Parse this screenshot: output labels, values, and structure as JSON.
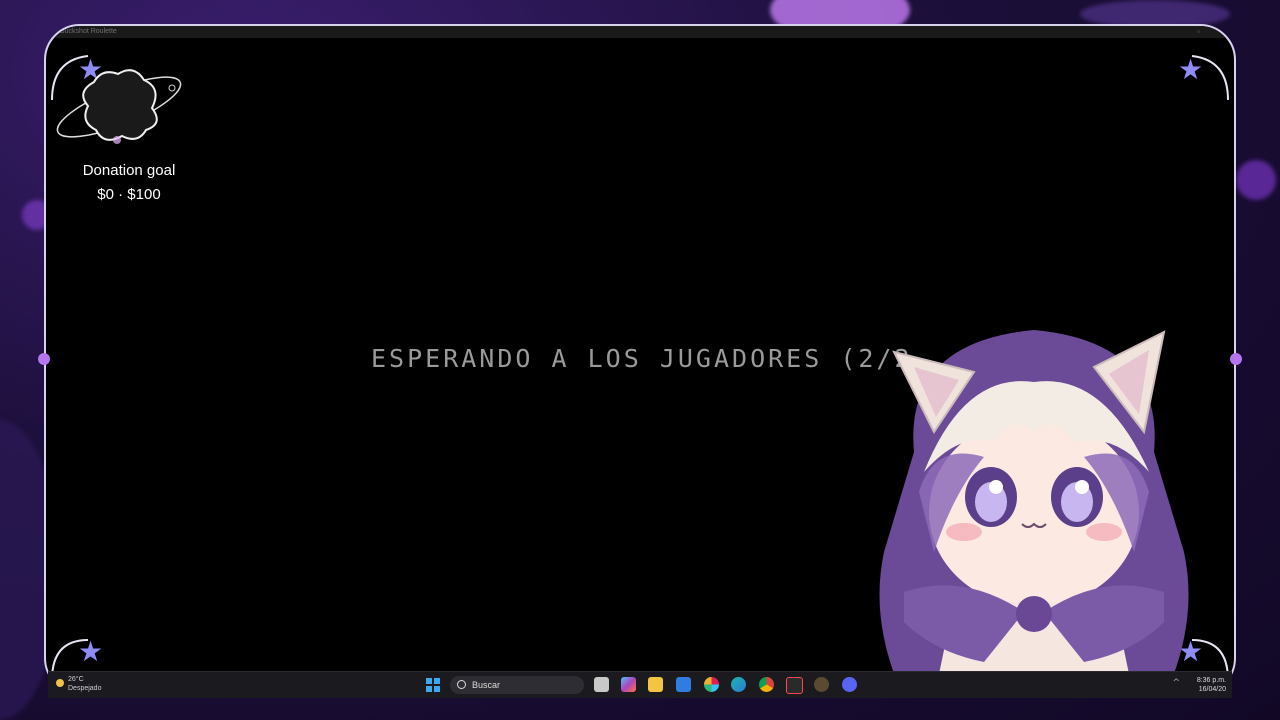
{
  "window": {
    "title": "Buckshot Roulette"
  },
  "game": {
    "status_text": "ESPERANDO A LOS JUGADORES (2/2"
  },
  "donation": {
    "title": "Donation goal",
    "amount": "$0 · $100"
  },
  "taskbar": {
    "weather_temp": "26°C",
    "weather_desc": "Despejado",
    "search_placeholder": "Buscar",
    "time": "8:36 p.m.",
    "date": "16/04/20",
    "apps": [
      "file-explorer",
      "copilot",
      "folder",
      "store",
      "slack",
      "edge",
      "chrome",
      "valorant",
      "game-launcher",
      "discord"
    ]
  },
  "colors": {
    "accent": "#b574f0",
    "star": "#8f8cf6",
    "frame": "#d9d2ee"
  }
}
